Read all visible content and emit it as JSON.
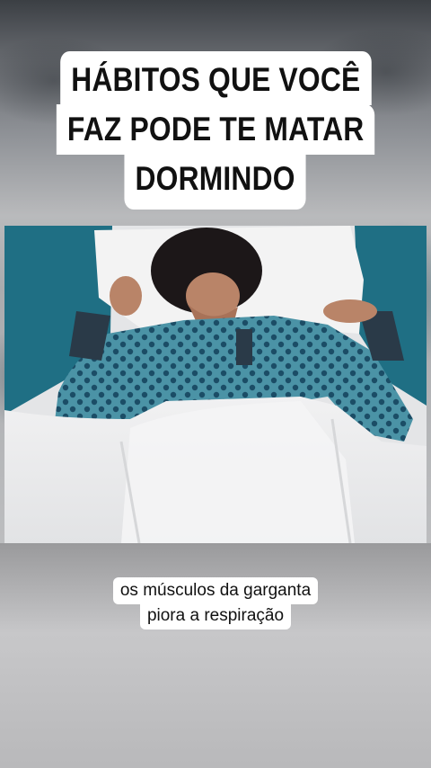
{
  "title": {
    "lines": [
      "HÁBITOS QUE VOCÊ",
      "FAZ PODE TE MATAR",
      "DORMINDO"
    ]
  },
  "video": {
    "scene": "person-sleeping",
    "colors": {
      "pillow_blue": "#1f6f84",
      "pajama_blue": "#4b93a6",
      "pajama_dots": "#1b4d66",
      "sheet": "#ededee"
    }
  },
  "caption": {
    "lines": [
      "os músculos da garganta",
      "piora a respiração"
    ]
  }
}
